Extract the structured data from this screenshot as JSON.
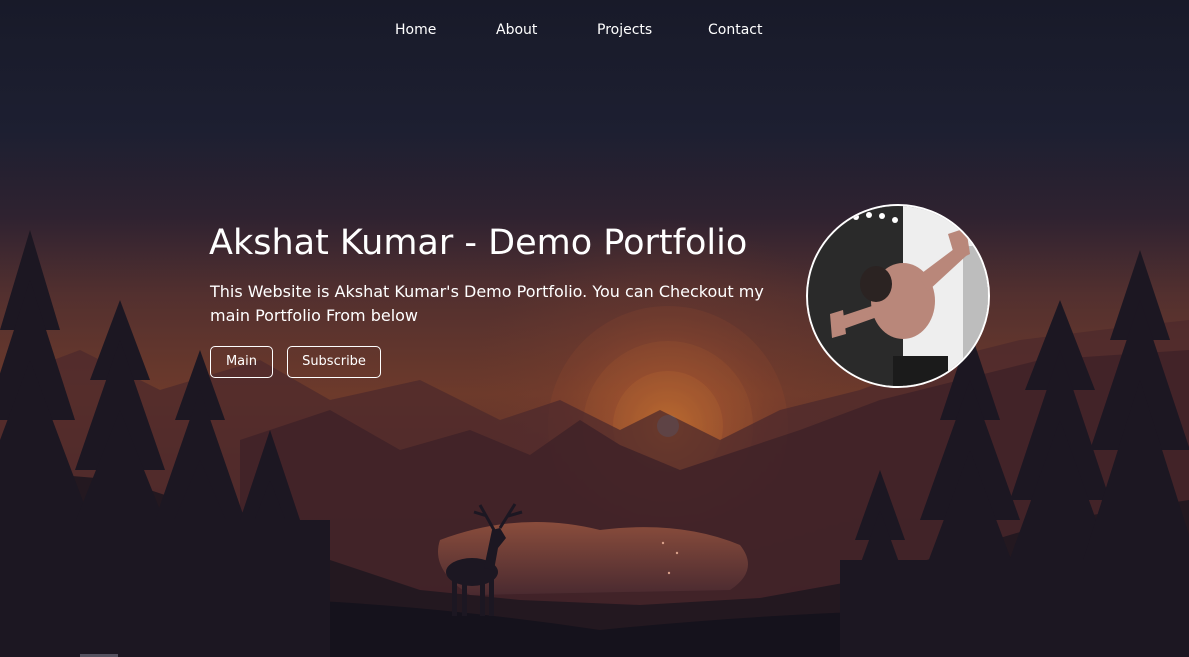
{
  "nav": {
    "items": [
      {
        "label": "Home"
      },
      {
        "label": "About"
      },
      {
        "label": "Projects"
      },
      {
        "label": "Contact"
      }
    ]
  },
  "hero": {
    "title": "Akshat Kumar - Demo Portfolio",
    "description": "This Website is Akshat Kumar's Demo Portfolio. You can Checkout my main Portfolio From below",
    "buttons": {
      "main_label": "Main",
      "subscribe_label": "Subscribe"
    }
  },
  "colors": {
    "sky_top": "#1b1c2c",
    "sky_glow": "#7a3d2a",
    "text": "#ffffff",
    "foreground": "#15121c"
  },
  "icons": {
    "avatar": "profile-photo"
  }
}
